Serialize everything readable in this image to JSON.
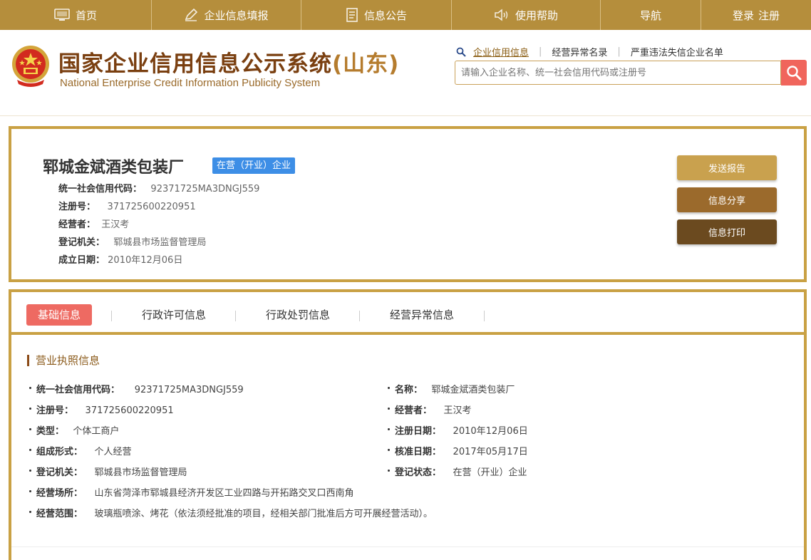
{
  "nav": {
    "home": "首页",
    "fill": "企业信息填报",
    "notice": "信息公告",
    "help": "使用帮助",
    "guide": "导航",
    "login": "登录",
    "register": "注册"
  },
  "header": {
    "title_cn": "国家企业信用信息公示系统",
    "title_prov": "(山东)",
    "title_en": "National Enterprise Credit Information Publicity System",
    "links": [
      "企业信用信息",
      "经营异常名录",
      "严重违法失信企业名单"
    ],
    "search_placeholder": "请输入企业名称、统一社会信用代码或注册号"
  },
  "summary": {
    "name": "郓城金斌酒类包装厂",
    "status": "在营（开业）企业",
    "rows": [
      {
        "k": "统一社会信用代码：",
        "v": "92371725MA3DNGJ559"
      },
      {
        "k": "注册号：",
        "v": "371725600220951"
      },
      {
        "k": "经营者：",
        "v": "王汉考"
      },
      {
        "k": "登记机关：",
        "v": "郓城县市场监督管理局"
      },
      {
        "k": "成立日期：",
        "v": "2010年12月06日"
      }
    ],
    "buttons": [
      "发送报告",
      "信息分享",
      "信息打印"
    ]
  },
  "tabs": [
    "基础信息",
    "行政许可信息",
    "行政处罚信息",
    "经营异常信息"
  ],
  "license": {
    "title": "营业执照信息",
    "left": [
      {
        "k": "统一社会信用代码：",
        "v": "92371725MA3DNGJ559"
      },
      {
        "k": "注册号：",
        "v": "371725600220951"
      },
      {
        "k": "类型：",
        "v": "个体工商户"
      },
      {
        "k": "组成形式：",
        "v": "个人经营"
      },
      {
        "k": "登记机关：",
        "v": "郓城县市场监督管理局"
      },
      {
        "k": "经营场所：",
        "v": "山东省菏泽市郓城县经济开发区工业四路与开拓路交叉口西南角"
      },
      {
        "k": "经营范围：",
        "v": "玻璃瓶喷涂、烤花（依法须经批准的项目，经相关部门批准后方可开展经营活动）。"
      }
    ],
    "right": [
      {
        "k": "名称：",
        "v": "郓城金斌酒类包装厂"
      },
      {
        "k": "经营者：",
        "v": "王汉考"
      },
      {
        "k": "注册日期：",
        "v": "2010年12月06日"
      },
      {
        "k": "核准日期：",
        "v": "2017年05月17日"
      },
      {
        "k": "登记状态：",
        "v": "在营（开业）企业"
      }
    ]
  },
  "colors": {
    "gold": "#b58e3c",
    "border": "#c9a144",
    "tag_blue": "#3d8ee6",
    "tab_red": "#ee6a62",
    "btn_send": "#c9a14e",
    "btn_share": "#9b6a2c",
    "btn_print": "#6b4a1f"
  }
}
